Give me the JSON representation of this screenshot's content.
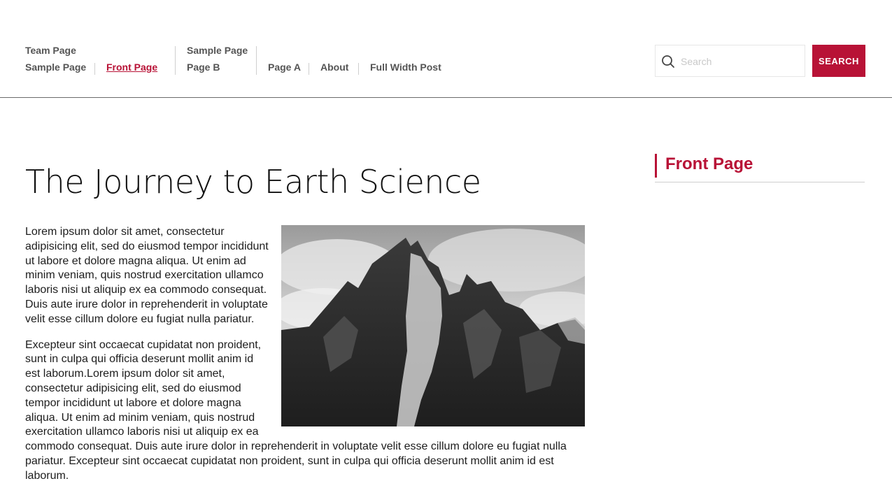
{
  "nav": {
    "group1": [
      "Team Page",
      "Sample Page",
      "Front Page"
    ],
    "group2": [
      "Sample Page",
      "Page B"
    ],
    "group3": [
      "Page A",
      "About",
      "Full Width Post"
    ],
    "active": "Front Page"
  },
  "search": {
    "placeholder": "Search",
    "button_label": "SEARCH",
    "icon": "search-icon"
  },
  "main": {
    "title": "The Journey to Earth Science",
    "paragraphs": [
      "Lorem ipsum dolor sit amet, consectetur adipisicing elit, sed do eiusmod tempor incididunt ut labore et dolore magna aliqua. Ut enim ad minim veniam, quis nostrud exercitation ullamco laboris nisi ut aliquip ex ea commodo consequat. Duis aute irure dolor in reprehenderit in voluptate velit esse cillum dolore eu fugiat nulla pariatur.",
      "Excepteur sint occaecat cupidatat non proident, sunt in culpa qui officia deserunt mollit anim id est laborum.Lorem ipsum dolor sit amet, consectetur adipisicing elit, sed do eiusmod tempor incididunt ut labore et dolore magna aliqua. Ut enim ad minim veniam, quis nostrud exercitation ullamco laboris nisi ut aliquip ex ea commodo consequat. Duis aute irure dolor in reprehenderit in voluptate velit esse cillum dolore eu fugiat nulla pariatur. Excepteur sint occaecat cupidatat non proident, sunt in culpa qui officia deserunt mollit anim id est laborum."
    ]
  },
  "sidebar": {
    "widget_title": "Front Page"
  },
  "colors": {
    "accent": "#b81236",
    "nav_text": "#555555"
  }
}
